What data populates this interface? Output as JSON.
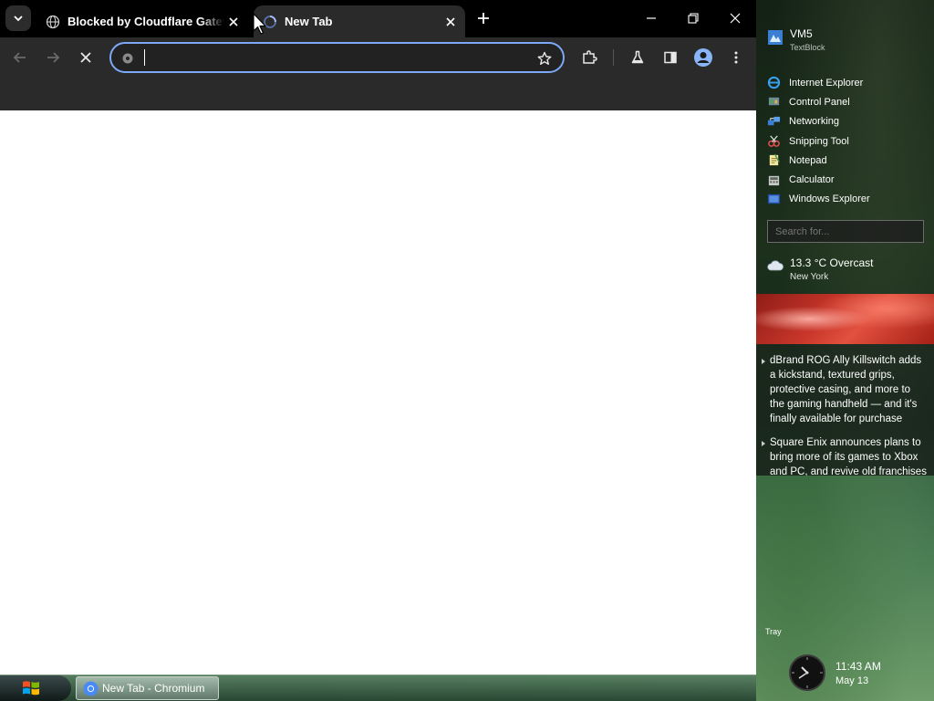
{
  "browser": {
    "tabs": [
      {
        "title": "Blocked by Cloudflare Gateway",
        "active": false
      },
      {
        "title": "New Tab",
        "active": true
      }
    ],
    "omnibox": {
      "value": "",
      "placeholder": ""
    }
  },
  "sidebar": {
    "vm_name": "VM5",
    "vm_subtitle": "TextBlock",
    "launcher": [
      {
        "label": "Internet Explorer",
        "icon": "internet-explorer-icon"
      },
      {
        "label": "Control Panel",
        "icon": "control-panel-icon"
      },
      {
        "label": "Networking",
        "icon": "networking-icon"
      },
      {
        "label": "Snipping Tool",
        "icon": "snipping-tool-icon"
      },
      {
        "label": "Notepad",
        "icon": "notepad-icon"
      },
      {
        "label": "Calculator",
        "icon": "calculator-icon"
      },
      {
        "label": "Windows Explorer",
        "icon": "windows-explorer-icon"
      }
    ],
    "search_placeholder": "Search for...",
    "weather": {
      "temp": "13.3 °C Overcast",
      "city": "New York"
    },
    "news": [
      {
        "text": "dBrand ROG Ally Killswitch adds a kickstand, textured grips, protective casing, and more to the gaming handheld — and it's finally available for purchase"
      },
      {
        "text": "Square Enix announces plans to bring more of its games to Xbox and PC, and revive old franchises"
      }
    ],
    "tray_label": "Tray",
    "clock": {
      "time": "11:43 AM",
      "date": "May 13"
    }
  },
  "taskbar": {
    "items": [
      {
        "label": "New Tab - Chromium",
        "icon": "chromium-icon"
      }
    ]
  },
  "colors": {
    "tabstrip_bg": "#000000",
    "toolbar_bg": "#2a2a2a",
    "omnibox_focus": "#7ca8f8",
    "active_tab_bg": "#2a2a2a"
  }
}
